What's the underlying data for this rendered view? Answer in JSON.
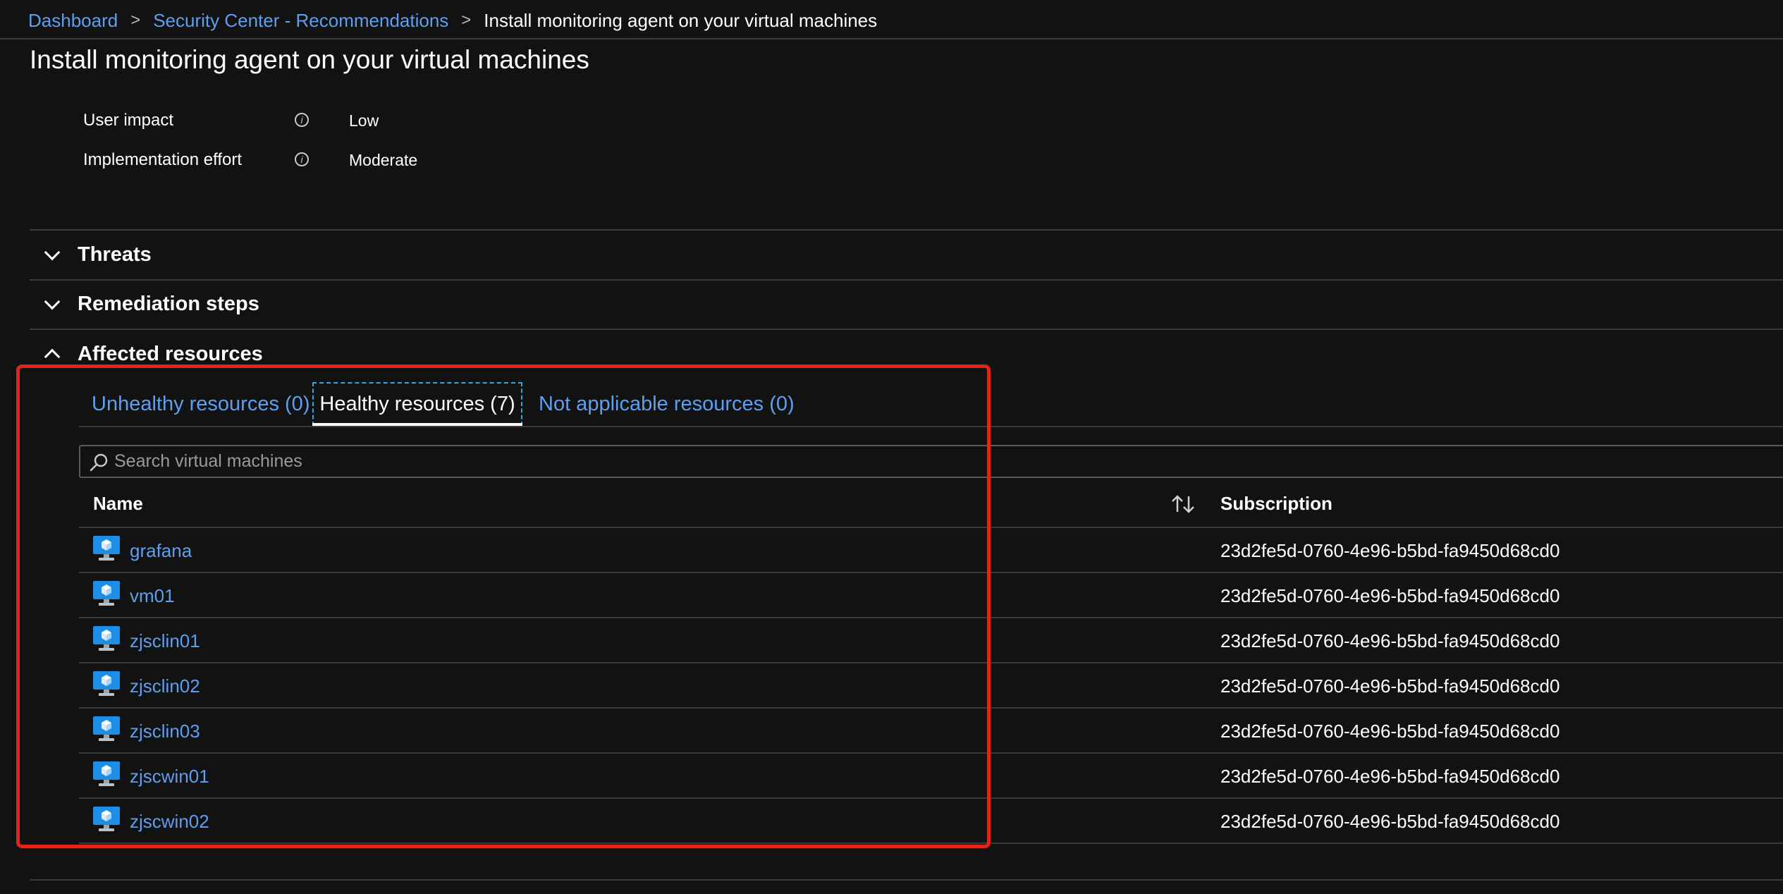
{
  "breadcrumb": {
    "items": [
      "Dashboard",
      "Security Center - Recommendations"
    ],
    "current": "Install monitoring agent on your virtual machines",
    "separator": ">"
  },
  "page": {
    "title": "Install monitoring agent on your virtual machines"
  },
  "properties": [
    {
      "label": "User impact",
      "value": "Low"
    },
    {
      "label": "Implementation effort",
      "value": "Moderate"
    }
  ],
  "sections": [
    {
      "label": "Threats",
      "expanded": false
    },
    {
      "label": "Remediation steps",
      "expanded": false
    },
    {
      "label": "Affected resources",
      "expanded": true
    }
  ],
  "tabs": [
    {
      "label": "Unhealthy resources (0)",
      "selected": false
    },
    {
      "label": "Healthy resources (7)",
      "selected": true
    },
    {
      "label": "Not applicable resources (0)",
      "selected": false
    }
  ],
  "search": {
    "placeholder": "Search virtual machines",
    "value": ""
  },
  "table": {
    "columns": [
      "Name",
      "Subscription"
    ],
    "rows": [
      {
        "name": "grafana",
        "subscription": "23d2fe5d-0760-4e96-b5bd-fa9450d68cd0"
      },
      {
        "name": "vm01",
        "subscription": "23d2fe5d-0760-4e96-b5bd-fa9450d68cd0"
      },
      {
        "name": "zjsclin01",
        "subscription": "23d2fe5d-0760-4e96-b5bd-fa9450d68cd0"
      },
      {
        "name": "zjsclin02",
        "subscription": "23d2fe5d-0760-4e96-b5bd-fa9450d68cd0"
      },
      {
        "name": "zjsclin03",
        "subscription": "23d2fe5d-0760-4e96-b5bd-fa9450d68cd0"
      },
      {
        "name": "zjscwin01",
        "subscription": "23d2fe5d-0760-4e96-b5bd-fa9450d68cd0"
      },
      {
        "name": "zjscwin02",
        "subscription": "23d2fe5d-0760-4e96-b5bd-fa9450d68cd0"
      }
    ]
  },
  "icons": {
    "breadcrumb_separator": "chevron-right-icon",
    "info": "info-icon",
    "collapsed": "chevron-down-icon",
    "expanded": "chevron-up-icon",
    "search": "search-icon",
    "sort": "sort-icon",
    "vm": "virtual-machine-icon"
  },
  "colors": {
    "background": "#121212",
    "link": "#5d9ff0",
    "highlight": "#e3241b",
    "tab_focus": "#35a8dd",
    "vm_icon": "#1d8ee6"
  }
}
